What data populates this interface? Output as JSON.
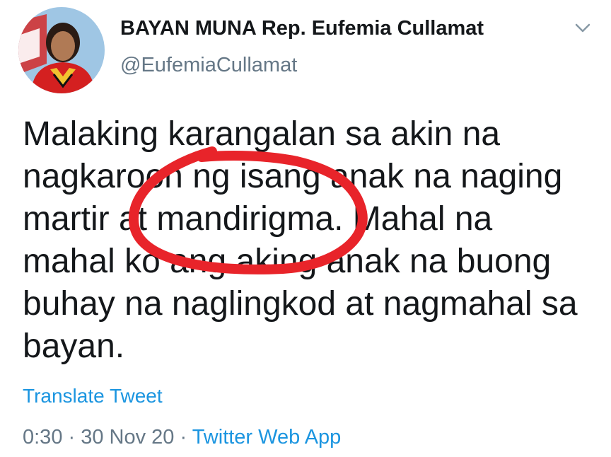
{
  "author": {
    "display_name": "BAYAN MUNA Rep. Eufemia Cullamat",
    "handle": "@EufemiaCullamat",
    "avatar_icon": "profile-photo"
  },
  "menu_icon": "chevron-down-icon",
  "tweet": {
    "lines": [
      "Malaking karangalan sa akin na",
      "nagkaroon ng isang anak na naging",
      "martir at mandirigma. Mahal na",
      "mahal ko ang aking anak na buong",
      "buhay na naglingkod at nagmahal sa",
      "bayan."
    ],
    "annotation_color": "#e8242a"
  },
  "translate_label": "Translate Tweet",
  "meta": {
    "time": "0:30",
    "separator": " · ",
    "date": "30 Nov 20",
    "source": "Twitter Web App"
  },
  "colors": {
    "link": "#1b95e0",
    "secondary": "#657786",
    "text": "#14171a"
  }
}
